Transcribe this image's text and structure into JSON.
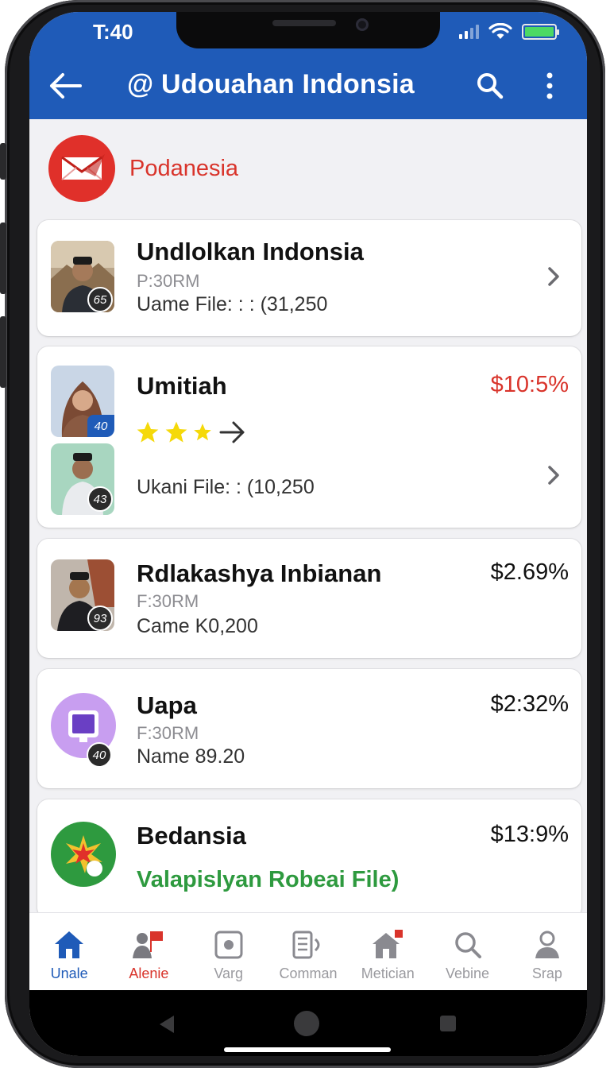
{
  "status_bar": {
    "time": "T:40"
  },
  "app_bar": {
    "title": "@ Udouahan Indonsia",
    "back_icon": "back-arrow-icon",
    "search_icon": "search-icon",
    "more_icon": "more-vertical-icon"
  },
  "section": {
    "title": "Podanesia",
    "logo_icon": "mail-logo-icon",
    "logo_color": "#e0302a"
  },
  "items": [
    {
      "title": "Undlolkan Indonsia",
      "sub": "P:30RM",
      "meta": "Uame File: : : (31,250",
      "badge": "65",
      "price": ""
    },
    {
      "title": "Umitiah",
      "sub": "",
      "meta": "Ukani File: : (10,250",
      "badge": "40",
      "badge2": "43",
      "price": "$10:5%",
      "rating_stars": 3
    },
    {
      "title": "Rdlakashya Inbianan",
      "sub": "F:30RM",
      "meta": "Came K0,200",
      "badge": "93",
      "price": "$2.69%"
    },
    {
      "title": "Uapa",
      "sub": "F:30RM",
      "meta": "Name 89.20",
      "badge": "40",
      "price": "$2:32%"
    },
    {
      "title": "Bedansia",
      "sub": "",
      "meta": "Valapislyan Robeai File)",
      "price": "$13:9%"
    }
  ],
  "nav": [
    {
      "label": "Unale",
      "icon": "home-icon",
      "state": "active"
    },
    {
      "label": "Alenie",
      "icon": "people-flag-icon",
      "state": "alert"
    },
    {
      "label": "Varg",
      "icon": "record-icon",
      "state": ""
    },
    {
      "label": "Comman",
      "icon": "document-audio-icon",
      "state": ""
    },
    {
      "label": "Metician",
      "icon": "house-badge-icon",
      "state": ""
    },
    {
      "label": "Vebine",
      "icon": "search-icon",
      "state": ""
    },
    {
      "label": "Srap",
      "icon": "profile-icon",
      "state": ""
    }
  ],
  "colors": {
    "header": "#1f5bb8",
    "accent_red": "#d9342b",
    "accent_green": "#2e9a3f",
    "star": "#f5d90a"
  }
}
